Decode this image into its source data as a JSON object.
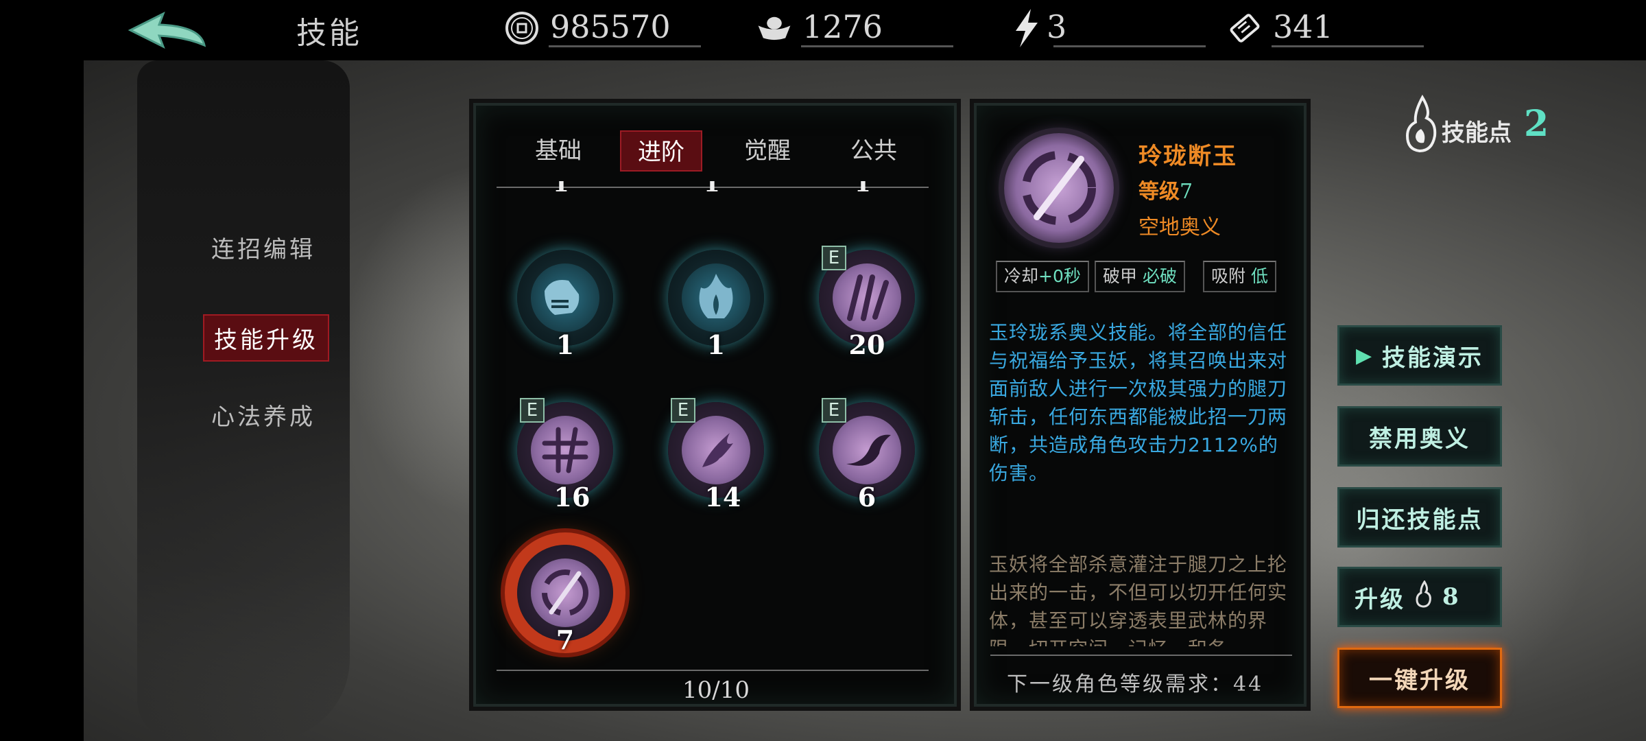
{
  "topbar": {
    "title": "技能",
    "resources": [
      {
        "icon": "coin-icon",
        "value": "985570"
      },
      {
        "icon": "ingot-icon",
        "value": "1276"
      },
      {
        "icon": "lightning-icon",
        "value": "3"
      },
      {
        "icon": "ticket-icon",
        "value": "341"
      }
    ]
  },
  "menu": {
    "items": [
      "连招编辑",
      "技能升级",
      "心法养成"
    ],
    "active": "技能升级"
  },
  "skills": {
    "tabs": [
      "基础",
      "进阶",
      "觉醒",
      "公共"
    ],
    "active_tab": "进阶",
    "partial_row_levels": [
      "1",
      "1",
      "1"
    ],
    "items": [
      {
        "level": "1",
        "style": "teal",
        "badge": "",
        "icon": "fist-skill-icon"
      },
      {
        "level": "1",
        "style": "teal",
        "badge": "",
        "icon": "flame-skill-icon"
      },
      {
        "level": "20",
        "style": "purple",
        "badge": "E",
        "icon": "claw-skill-icon"
      },
      {
        "level": "16",
        "style": "purple",
        "badge": "E",
        "icon": "cross-slash-skill-icon"
      },
      {
        "level": "14",
        "style": "purple",
        "badge": "E",
        "icon": "phoenix-skill-icon"
      },
      {
        "level": "6",
        "style": "purple",
        "badge": "E",
        "icon": "wave-skill-icon"
      },
      {
        "level": "7",
        "style": "purple",
        "badge": "",
        "icon": "blade-ring-skill-icon",
        "selected": true
      }
    ],
    "pager": "10/10"
  },
  "detail": {
    "name": "玲珑断玉",
    "grade_label": "等级",
    "grade_value": "7",
    "type": "空地奥义",
    "stats": [
      {
        "label": "冷却",
        "value": "+0秒"
      },
      {
        "label": "破甲 ",
        "value": "必破"
      },
      {
        "label": "吸附 ",
        "value": "低"
      }
    ],
    "description": "玉玲珑系奥义技能。将全部的信任与祝福给予玉妖，将其召唤出来对面前敌人进行一次极其强力的腿刀斩击，任何东西都能被此招一刀两断，共造成角色攻击力2112%的伤害。",
    "lore": "玉妖将全部杀意灌注于腿刀之上抡出来的一击，不但可以切开任何实体，甚至可以穿透表里武林的界限，切开空间、记忆、和各",
    "requirement": "下一级角色等级需求：44"
  },
  "skill_points": {
    "label": "技能点",
    "value": "2"
  },
  "buttons": {
    "demo": "技能演示",
    "disable": "禁用奥义",
    "refund": "归还技能点",
    "upgrade_label": "升级",
    "upgrade_cost": "8",
    "one_click": "一键升级"
  },
  "colors": {
    "accent_red": "#5a0d12",
    "orange": "#ee8a25",
    "teal": "#5fe0c4",
    "desc_blue": "#39a8e0"
  }
}
